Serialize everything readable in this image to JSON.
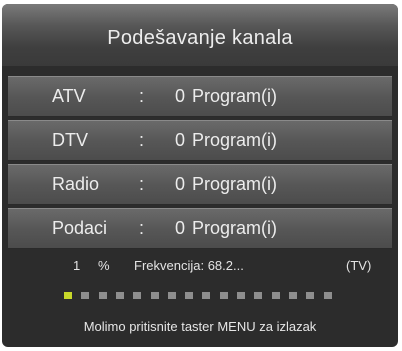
{
  "title": "Podešavanje kanala",
  "rows": [
    {
      "name": "ATV",
      "colon": ":",
      "count": "0",
      "unit": "Program(i)"
    },
    {
      "name": "DTV",
      "colon": ":",
      "count": "0",
      "unit": "Program(i)"
    },
    {
      "name": "Radio",
      "colon": ":",
      "count": "0",
      "unit": "Program(i)"
    },
    {
      "name": "Podaci",
      "colon": ":",
      "count": "0",
      "unit": "Program(i)"
    }
  ],
  "status": {
    "percent_value": "1",
    "percent_symbol": "%",
    "frequency": "Frekvencija: 68.2...",
    "mode": "(TV)"
  },
  "progress": {
    "fraction": 0.01,
    "segments_total": 16,
    "segments_filled": 1,
    "filled_color": "#c8d82a",
    "empty_color": "#8e8e8e"
  },
  "footer": "Molimo pritisnite taster MENU za izlazak"
}
